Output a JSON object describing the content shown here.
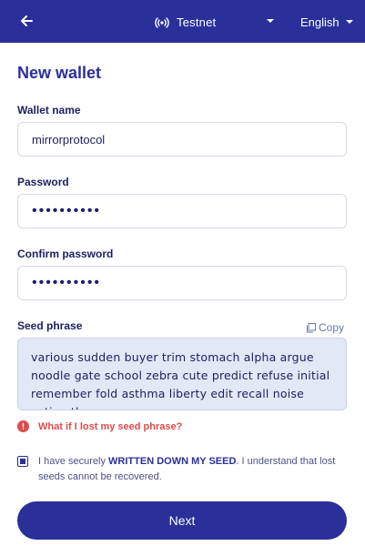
{
  "header": {
    "network_label": "Testnet",
    "language_label": "English"
  },
  "page": {
    "title": "New wallet"
  },
  "form": {
    "wallet_name_label": "Wallet name",
    "wallet_name_value": "mirrorprotocol",
    "password_label": "Password",
    "password_value": "••••••••••",
    "confirm_password_label": "Confirm password",
    "confirm_password_value": "••••••••••",
    "seed_phrase_label": "Seed phrase",
    "copy_label": "Copy",
    "seed_phrase_value": "various sudden buyer trim stomach alpha argue noodle gate school zebra cute predict refuse initial remember fold asthma liberty edit recall noise action they",
    "warning_link": "What if I lost my seed phrase?",
    "agree_pre": "I have securely ",
    "agree_emphasis": "WRITTEN DOWN MY SEED",
    "agree_post": ". I understand that lost seeds cannot be recovered.",
    "agree_checked": true,
    "next_label": "Next"
  },
  "colors": {
    "brand": "#2a2f9a",
    "warning": "#e04a4a",
    "seed_background": "#e3e8f6"
  },
  "icons": {
    "back": "arrow-left-icon",
    "network": "antenna-icon",
    "caret": "caret-down-icon",
    "copy": "copy-icon",
    "warning": "alert-circle-icon"
  }
}
